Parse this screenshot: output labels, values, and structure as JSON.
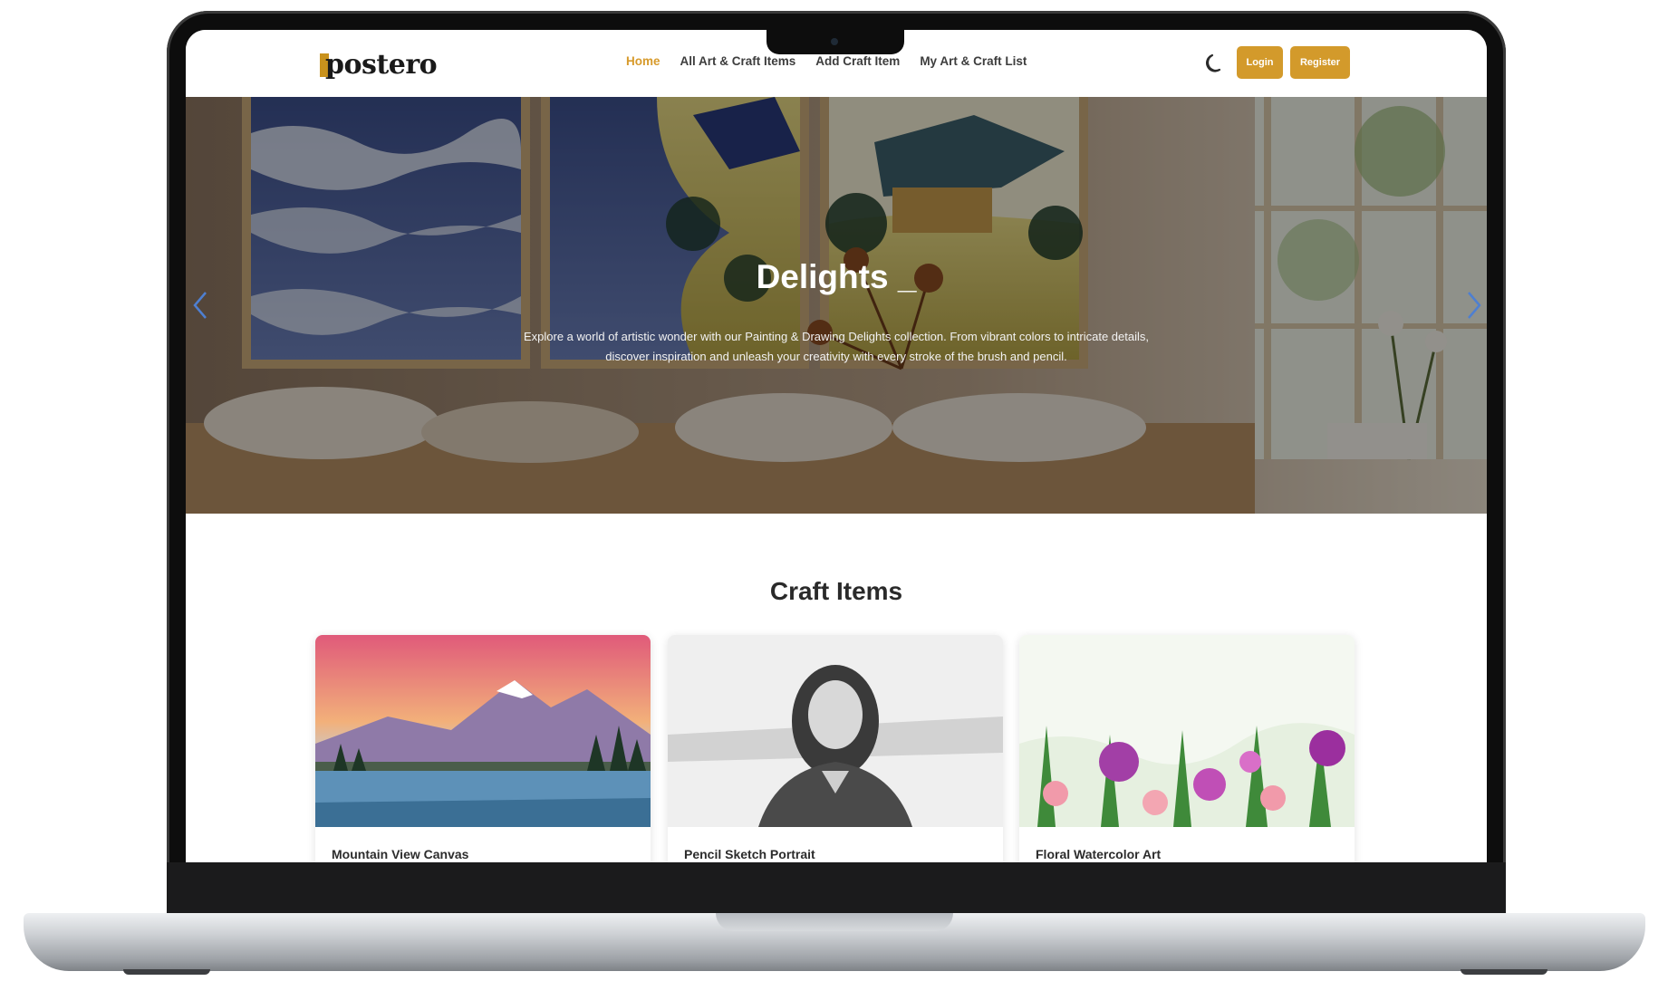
{
  "brand": {
    "name": "postero",
    "accent_color": "#d39a2b"
  },
  "nav": {
    "links": [
      {
        "label": "Home",
        "active": true
      },
      {
        "label": "All Art & Craft Items",
        "active": false
      },
      {
        "label": "Add Craft Item",
        "active": false
      },
      {
        "label": "My Art & Craft List",
        "active": false
      }
    ],
    "theme_toggle_icon": "moon-icon",
    "login_label": "Login",
    "register_label": "Register"
  },
  "hero": {
    "title": "Delights _",
    "description": "Explore a world of artistic wonder with our Painting & Drawing Delights collection. From vibrant colors to intricate details, discover inspiration and unleash your creativity with every stroke of the brush and pencil.",
    "prev_icon": "chevron-left-icon",
    "next_icon": "chevron-right-icon"
  },
  "craft_section": {
    "title": "Craft Items",
    "items": [
      {
        "title": "Mountain View Canvas"
      },
      {
        "title": "Pencil Sketch Portrait"
      },
      {
        "title": "Floral Watercolor Art"
      }
    ]
  }
}
